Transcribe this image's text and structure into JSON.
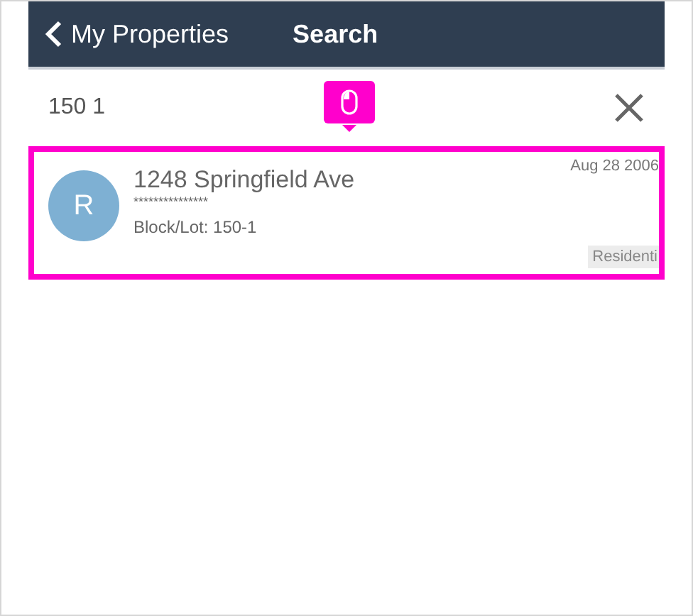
{
  "header": {
    "back_label": "My Properties",
    "title": "Search"
  },
  "search": {
    "value": "150 1"
  },
  "results": [
    {
      "avatar": "R",
      "address": "1248 Springfield Ave",
      "masked": "***************",
      "block_lot": "Block/Lot: 150-1",
      "date": "Aug 28 2006",
      "tag": "Residenti",
      "highlighted": true
    }
  ]
}
